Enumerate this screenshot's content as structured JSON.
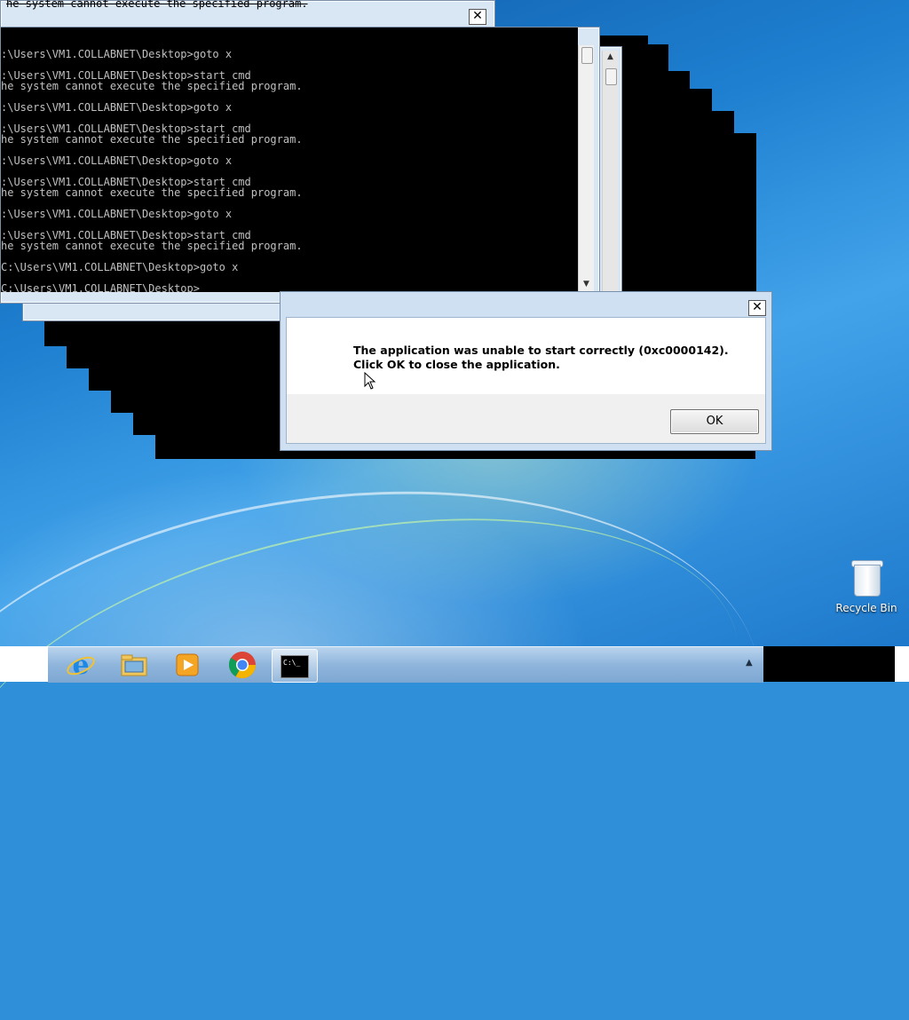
{
  "desktop": {
    "recycle_bin": {
      "label": "Recycle Bin",
      "icon": "recycle-bin-icon"
    }
  },
  "back_window": {
    "title_text": "he system cannot execute the specified program.",
    "close_label": "✕"
  },
  "console_window": {
    "lines": [
      ":\\Users\\VM1.COLLABNET\\Desktop>goto x",
      "",
      ":\\Users\\VM1.COLLABNET\\Desktop>start cmd",
      "he system cannot execute the specified program.",
      "",
      ":\\Users\\VM1.COLLABNET\\Desktop>goto x",
      "",
      ":\\Users\\VM1.COLLABNET\\Desktop>start cmd",
      "he system cannot execute the specified program.",
      "",
      ":\\Users\\VM1.COLLABNET\\Desktop>goto x",
      "",
      ":\\Users\\VM1.COLLABNET\\Desktop>start cmd",
      "he system cannot execute the specified program.",
      "",
      ":\\Users\\VM1.COLLABNET\\Desktop>goto x",
      "",
      ":\\Users\\VM1.COLLABNET\\Desktop>start cmd",
      "he system cannot execute the specified program.",
      "",
      "C:\\Users\\VM1.COLLABNET\\Desktop>goto x",
      "",
      "C:\\Users\\VM1.COLLABNET\\Desktop>"
    ],
    "scroll_up": "▲",
    "scroll_down": "▼"
  },
  "error_dialog": {
    "message": "The application was unable to start correctly (0xc0000142). Click OK to close the application.",
    "ok_label": "OK",
    "close_label": "✕"
  },
  "taskbar": {
    "items": [
      {
        "name": "internet-explorer-icon",
        "active": false
      },
      {
        "name": "file-explorer-icon",
        "active": false
      },
      {
        "name": "media-player-icon",
        "active": false
      },
      {
        "name": "chrome-icon",
        "active": false
      },
      {
        "name": "command-prompt-icon",
        "active": true,
        "icon_text": "C:\\_"
      }
    ],
    "tray_arrow": "▲"
  },
  "colors": {
    "console_bg": "#000000",
    "console_text": "#c0c0c0",
    "desktop_blue": "#1e7fd0"
  }
}
